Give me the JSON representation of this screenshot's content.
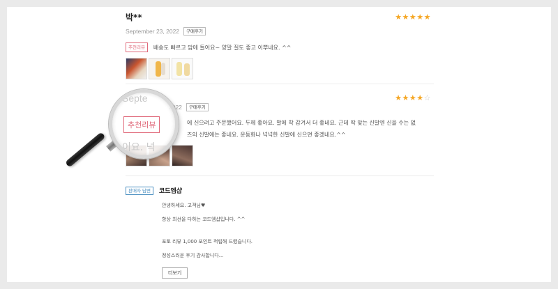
{
  "review1": {
    "name": "박**",
    "date": "September 23, 2022",
    "purchase_badge": "구매후기",
    "rating": 5,
    "stars_full": "★★★★★",
    "stars_empty": "",
    "recommended_badge": "추천리뷰",
    "text": "배송도 빠르고 맘에 들어요~ 양말 질도 좋고 이뿌네요. ^^"
  },
  "review2": {
    "date": "2022",
    "purchase_badge": "구매후기",
    "rating": 4,
    "stars_full": "★★★★",
    "stars_empty": "☆",
    "text_line1": "에 신으려고 주문했어요. 두께 좋아요. 발에 착 감겨서 더 좋네요. 근데 딱 맞는 신발엔 신을 수는 없",
    "text_line2": "즈의 신발에는 좋네요. 운동화나 넉넉한 신발에 신으면 좋겠네요.^^"
  },
  "magnifier": {
    "date_fragment": "Septe",
    "badge": "추천리뷰",
    "text_fragment": "이요. 넉"
  },
  "seller_reply": {
    "badge": "판매자 답변",
    "name": "코드엠샵",
    "line1": "안녕하세요. 고객님♥",
    "line2": "항상 최선을 다하는 코드엠샵입니다. ^^",
    "line3": "포토 리뷰 1,000 포인트 적립해 드렸습니다.",
    "line4": "정성스러운 후기 감사합니다...",
    "more_button": "더보기"
  },
  "colors": {
    "star": "#f5a623",
    "recommended": "#e0697a",
    "seller": "#4a8fc1"
  }
}
